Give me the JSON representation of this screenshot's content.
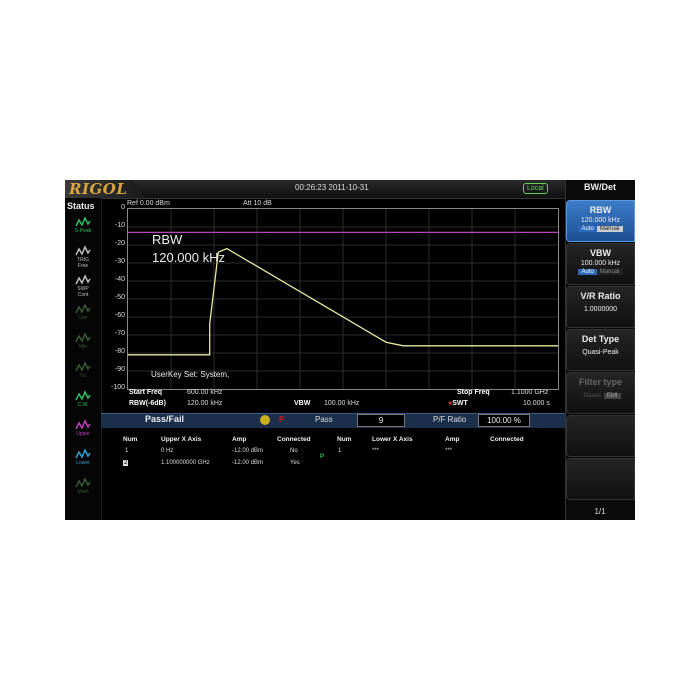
{
  "header": {
    "logo": "RIGOL",
    "datetime": "00:26:23 2011-10-31",
    "remote_status": "Local"
  },
  "status_panel": {
    "title": "Status",
    "items": [
      {
        "label": "S-Peak",
        "icon": "signal-peak-icon",
        "color": "#30c060"
      },
      {
        "label": "TRIG\nFree",
        "icon": "trigger-free-icon",
        "color": "#c0c0c0"
      },
      {
        "label": "SWP\nCont",
        "icon": "sweep-cont-icon",
        "color": "#c0c0c0"
      },
      {
        "label": "Corr",
        "icon": "correction-icon",
        "color": "#3a5a3a"
      },
      {
        "label": "Mkr",
        "icon": "marker-icon",
        "color": "#3a5a3a"
      },
      {
        "label": "Trc",
        "icon": "trace-icon",
        "color": "#3a5a3a"
      },
      {
        "label": "C.W.",
        "icon": "cw-icon",
        "color": "#30c060"
      },
      {
        "label": "Upper",
        "icon": "upper-limit-icon",
        "color": "#c040c0"
      },
      {
        "label": "Lower",
        "icon": "lower-limit-icon",
        "color": "#30a0d0"
      },
      {
        "label": "Math",
        "icon": "math-icon",
        "color": "#3a5a3a"
      }
    ]
  },
  "plot": {
    "ref_level": "Ref  0.00 dBm",
    "attenuation": "Att    10 dB",
    "overlay_line1": "RBW",
    "overlay_line2": "120.000 kHz",
    "user_key": "UserKey Set:   System,",
    "y_ticks": [
      "0",
      "-10",
      "-20",
      "-30",
      "-40",
      "-50",
      "-60",
      "-70",
      "-80",
      "-90",
      "-100"
    ],
    "start_freq_label": "Start Freq",
    "start_freq_value": "600.00 kHz",
    "stop_freq_label": "Stop Freq",
    "stop_freq_value": "1.1000 GHz",
    "rbw_label": "RBW(-6dB)",
    "rbw_value": "120.00 kHz",
    "vbw_label": "VBW",
    "vbw_value": "100.00 kHz",
    "swt_label": "SWT",
    "swt_value": "10.000 s",
    "limit_line_color": "#c040c0",
    "trace_color": "#e8e8a0"
  },
  "chart_data": {
    "type": "line",
    "ylim": [
      -100,
      0
    ],
    "xlim": [
      0,
      1
    ],
    "grid": true,
    "series": [
      {
        "x": [
          0,
          0.19,
          0.19,
          0.21,
          0.23,
          0.6,
          0.64,
          0.7,
          1.0
        ],
        "y": [
          -81,
          -81,
          -64,
          -24,
          -22,
          -74,
          -76,
          -76,
          -76
        ]
      },
      {
        "x": [
          0,
          1.0
        ],
        "y": [
          -13,
          -13
        ]
      }
    ]
  },
  "passfail": {
    "title": "Pass/Fail",
    "p_mark": "P",
    "result_label": "Pass",
    "result_count": "9",
    "ratio_label": "P/F Ratio",
    "ratio_value": "100.00 %",
    "upper_table": {
      "headers": [
        "Num",
        "Upper X Axis",
        "Amp",
        "Connected"
      ],
      "rows": [
        [
          "1",
          "0 Hz",
          "-12.00 dBm",
          "No"
        ],
        [
          "2",
          "1.100000000 GHz",
          "-12.00 dBm",
          "Yes"
        ]
      ]
    },
    "lower_table": {
      "headers": [
        "Num",
        "Lower X Axis",
        "Amp",
        "Connected"
      ],
      "rows": [
        [
          "1",
          "***",
          "***",
          ""
        ]
      ]
    },
    "mid_mark": "P"
  },
  "softkeys": {
    "menu_title": "BW/Det",
    "rbw": {
      "title": "RBW",
      "value": "120.000 kHz",
      "opt_auto": "Auto",
      "opt_manual": "Manual"
    },
    "vbw": {
      "title": "VBW",
      "value": "100.000 kHz",
      "opt_auto": "Auto",
      "opt_manual": "Manual"
    },
    "vr_ratio": {
      "title": "V/R Ratio",
      "value": "1.0000000"
    },
    "det_type": {
      "title": "Det Type",
      "value": "Quasi-Peak"
    },
    "filter_type": {
      "title": "Filter type",
      "opt_gauss": "Gauss",
      "opt_emi": "EMI"
    },
    "page": "1/1",
    "accent_color": "#2a6ab8"
  }
}
